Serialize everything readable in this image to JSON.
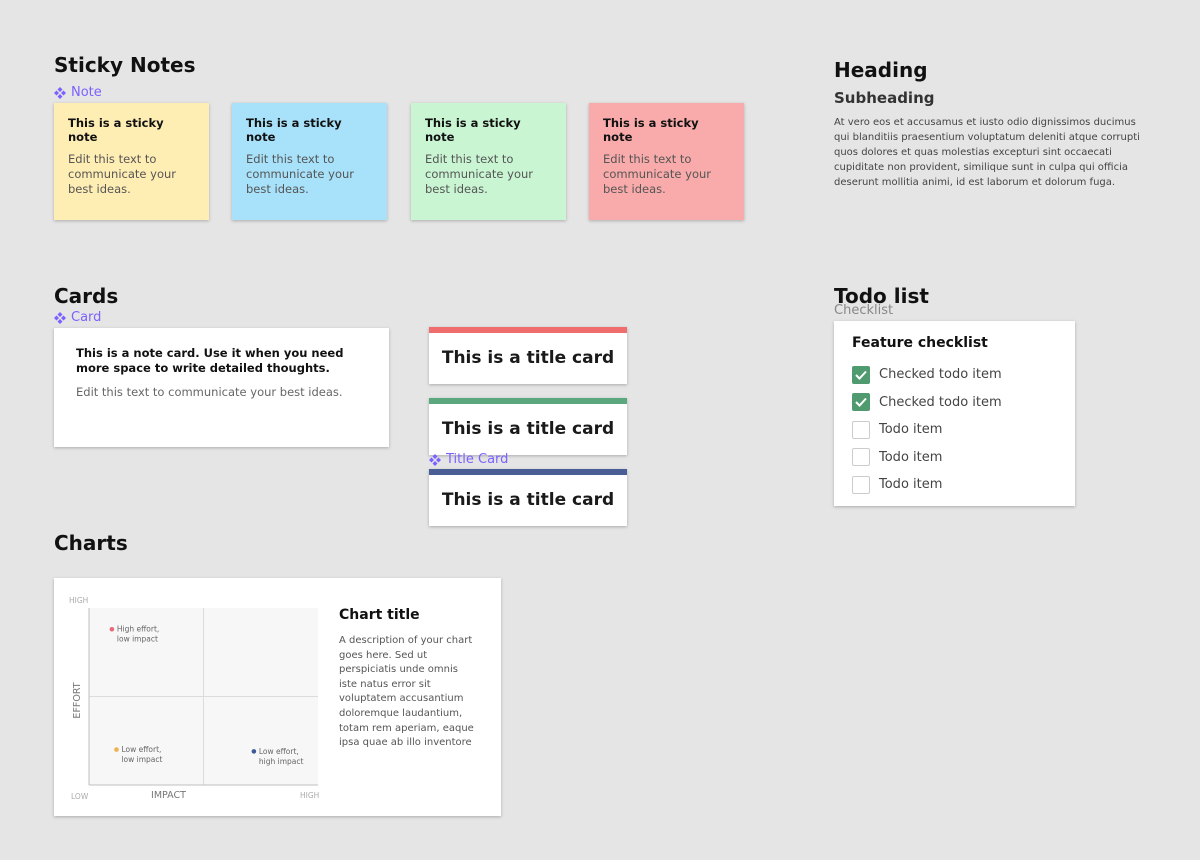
{
  "sticky_notes": {
    "title": "Sticky Notes",
    "component_label": "Note",
    "notes": [
      {
        "title": "This is a sticky note",
        "body": "Edit this text to communicate your best ideas.",
        "color": "#ffeeb4"
      },
      {
        "title": "This is a sticky note",
        "body": "Edit this text to communicate your best ideas.",
        "color": "#a8e2fa"
      },
      {
        "title": "This is a sticky note",
        "body": "Edit this text to communicate your best ideas.",
        "color": "#c9f5d3"
      },
      {
        "title": "This is a sticky note",
        "body": "Edit this text to communicate your best ideas.",
        "color": "#f8abaa"
      }
    ]
  },
  "heading_block": {
    "heading": "Heading",
    "subheading": "Subheading",
    "paragraph": "At vero eos et accusamus et iusto odio dignissimos ducimus qui blanditiis praesentium voluptatum deleniti atque corrupti quos dolores et quas molestias excepturi sint occaecati cupiditate non provident, similique sunt in culpa qui officia deserunt mollitia animi, id est laborum et dolorum fuga."
  },
  "cards": {
    "title": "Cards",
    "component_label": "Card",
    "note_card": {
      "title": "This is a note card. Use it when you need more space to write detailed thoughts.",
      "body": "Edit this text to communicate your best ideas."
    },
    "title_card_label": "Title Card",
    "title_cards": [
      {
        "text": "This is a title card",
        "color": "#f06d6d"
      },
      {
        "text": "This is a title card",
        "color": "#5ba77e"
      },
      {
        "text": "This is a title card",
        "color": "#4a5e96"
      }
    ]
  },
  "todo": {
    "title": "Todo list",
    "component_label": "Checklist",
    "card_title": "Feature checklist",
    "items": [
      {
        "label": "Checked todo item",
        "checked": true
      },
      {
        "label": "Checked todo item",
        "checked": true
      },
      {
        "label": "Todo item",
        "checked": false
      },
      {
        "label": "Todo item",
        "checked": false
      },
      {
        "label": "Todo item",
        "checked": false
      }
    ]
  },
  "charts": {
    "title": "Charts",
    "chart_title": "Chart title",
    "description": "A description of your chart goes here. Sed ut perspiciatis unde omnis iste natus error sit voluptatem accusantium doloremque laudantium, totam rem aperiam, eaque ipsa quae ab illo inventore"
  },
  "chart_data": {
    "type": "scatter",
    "title": "",
    "xlabel": "IMPACT",
    "ylabel": "EFFORT",
    "x_ticks": [
      "LOW",
      "HIGH"
    ],
    "y_ticks": [
      "LOW",
      "HIGH"
    ],
    "xlim": [
      0,
      1
    ],
    "ylim": [
      0,
      1
    ],
    "grid": "quadrants",
    "points": [
      {
        "label": "High effort, low impact",
        "x": 0.1,
        "y": 0.88,
        "color": "#e8697a"
      },
      {
        "label": "Low effort, low impact",
        "x": 0.12,
        "y": 0.2,
        "color": "#f0b24f"
      },
      {
        "label": "Low effort, high impact",
        "x": 0.72,
        "y": 0.19,
        "color": "#3d5a96"
      }
    ]
  }
}
